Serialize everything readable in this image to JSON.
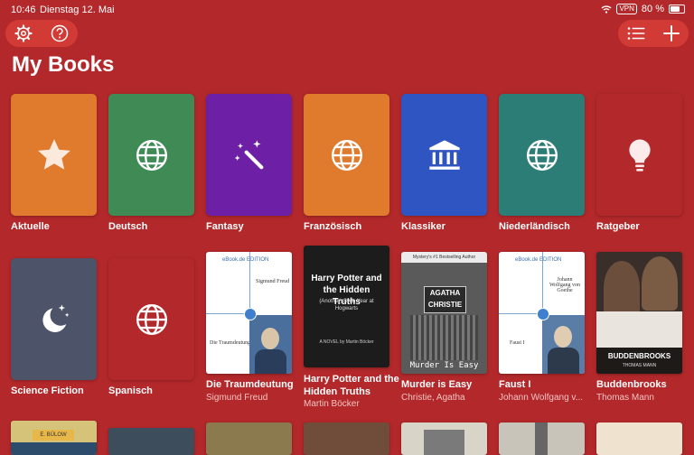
{
  "status": {
    "time": "10:46",
    "date": "Dienstag 12. Mai",
    "vpn": "VPN",
    "battery": "80 %"
  },
  "toolbar": {
    "settings_icon": "gear-icon",
    "help_icon": "question-icon",
    "list_icon": "list-icon",
    "add_icon": "plus-icon"
  },
  "page_title": "My Books",
  "folders": [
    {
      "label": "Aktuelle",
      "icon": "star-icon",
      "color": "#e07a2d"
    },
    {
      "label": "Deutsch",
      "icon": "globe-icon",
      "color": "#3f8a55"
    },
    {
      "label": "Fantasy",
      "icon": "magic-wand-icon",
      "color": "#6d1fa6"
    },
    {
      "label": "Französisch",
      "icon": "globe-icon",
      "color": "#e07a2d"
    },
    {
      "label": "Klassiker",
      "icon": "museum-icon",
      "color": "#2f55c2"
    },
    {
      "label": "Niederländisch",
      "icon": "globe-icon",
      "color": "#2d7d77"
    },
    {
      "label": "Ratgeber",
      "icon": "lightbulb-icon",
      "color": "#b3282a"
    },
    {
      "label": "Science Fiction",
      "icon": "moon-stars-icon",
      "color": "#4d5368"
    },
    {
      "label": "Spanisch",
      "icon": "globe-icon",
      "color": "#b3282a"
    }
  ],
  "books": [
    {
      "title": "Die Traumdeutung",
      "author": "Sigmund Freud",
      "cover_author": "Sigmund Freud",
      "cover_title": "Die Traumdeutung",
      "badge": "eBook.de EDITION"
    },
    {
      "title": "Harry Potter and the Hidden Truths",
      "author": "Martin Böcker",
      "cover_title": "Harry Potter and the Hidden Truths",
      "cover_sub": "(Another) Sixth Year at Hogwarts",
      "cover_foot": "A NOVEL by Martin Böcker"
    },
    {
      "title": "Murder is Easy",
      "author": "Christie, Agatha",
      "cover_top": "Mystery's #1 Bestselling Author",
      "cover_brand": "AGATHA CHRISTIE",
      "cover_title": "Murder Is Easy"
    },
    {
      "title": "Faust I",
      "author": "Johann Wolfgang v...",
      "cover_author": "Johann Wolfgang von Goethe",
      "cover_title": "Faust I",
      "badge": "eBook.de EDITION"
    },
    {
      "title": "Buddenbrooks",
      "author": "Thomas Mann",
      "cover_title": "BUDDENBROOKS",
      "cover_author": "THOMAS MANN"
    }
  ],
  "third_row_badge": "E. BÜLOW"
}
